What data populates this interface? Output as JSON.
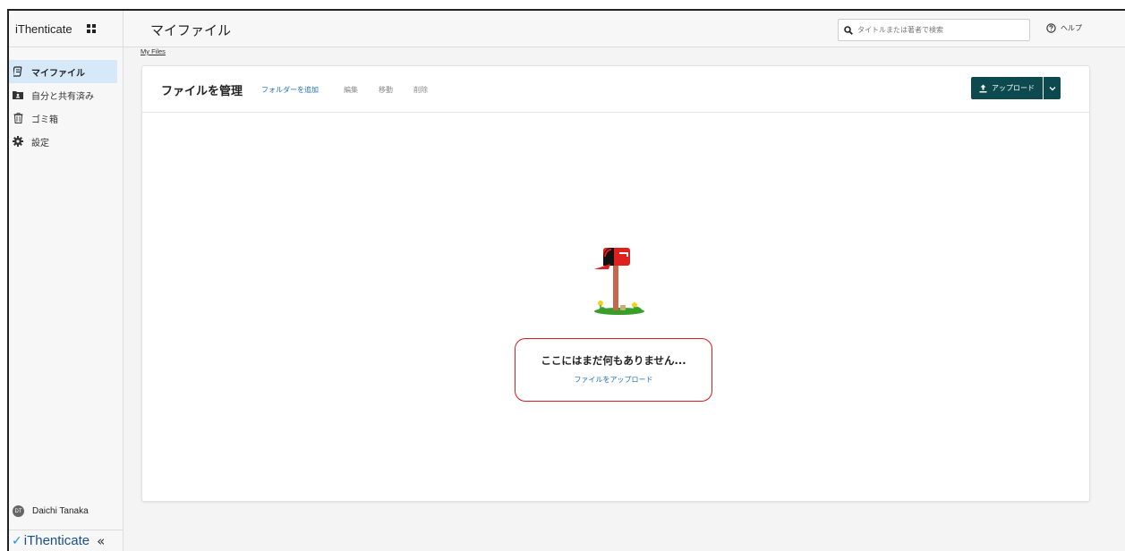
{
  "app": {
    "brand": "iThenticate",
    "footer_brand": "iThenticate"
  },
  "sidebar": {
    "items": [
      {
        "label": "マイファイル",
        "icon": "document-icon",
        "active": true
      },
      {
        "label": "自分と共有済み",
        "icon": "shared-folder-icon",
        "active": false
      },
      {
        "label": "ゴミ箱",
        "icon": "trash-icon",
        "active": false
      },
      {
        "label": "設定",
        "icon": "gear-icon",
        "active": false
      }
    ],
    "user": {
      "initials": "DT",
      "name": "Daichi Tanaka"
    },
    "collapse_glyph": "«"
  },
  "header": {
    "title": "マイファイル",
    "search_placeholder": "タイトルまたは著者で検索",
    "help_label": "ヘルプ"
  },
  "breadcrumb": "My Files",
  "toolbar": {
    "title": "ファイルを管理",
    "add_folder": "フォルダーを追加",
    "edit": "編集",
    "move": "移動",
    "delete": "削除",
    "upload": "アップロード"
  },
  "empty": {
    "title": "ここにはまだ何もありません...",
    "upload_link": "ファイルをアップロード"
  },
  "colors": {
    "accent": "#1a6fb8",
    "upload_button": "#0c4a4f",
    "active_nav": "#d6e9f8",
    "highlight_border": "#d81b1b"
  }
}
